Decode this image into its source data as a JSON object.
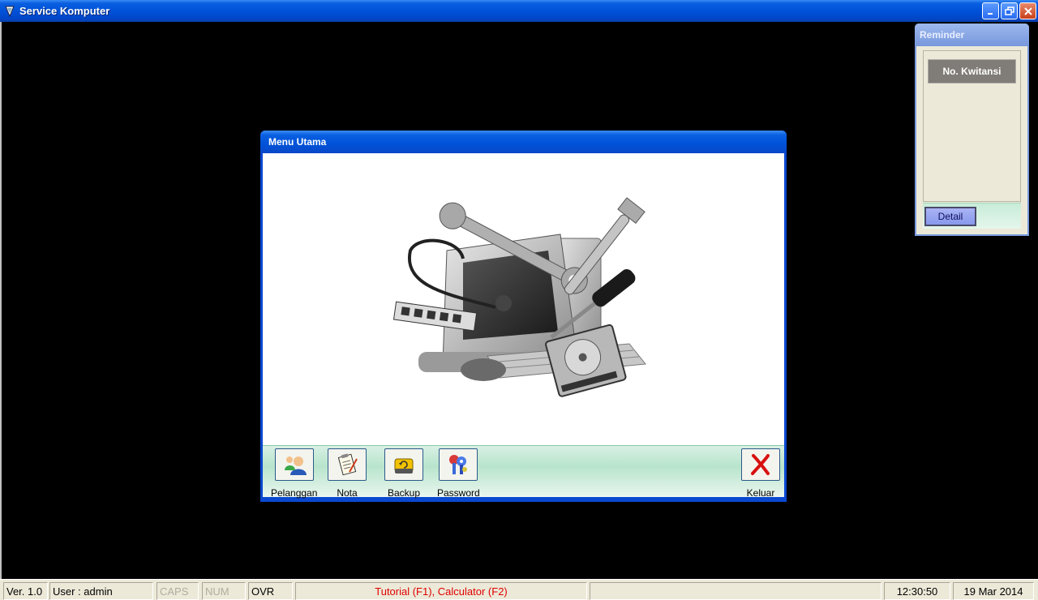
{
  "app": {
    "title": "Service Komputer"
  },
  "menu_window": {
    "title": "Menu Utama",
    "toolbar": [
      {
        "label": "Pelanggan",
        "icon": "customer-icon"
      },
      {
        "label": "Nota",
        "icon": "note-icon"
      },
      {
        "label": "Backup",
        "icon": "backup-icon"
      },
      {
        "label": "Password",
        "icon": "password-keys-icon"
      },
      {
        "label": "Keluar",
        "icon": "exit-icon"
      }
    ]
  },
  "reminder_window": {
    "title": "Reminder",
    "column_header": "No. Kwitansi",
    "detail_button": "Detail"
  },
  "statusbar": {
    "version": "Ver. 1.0",
    "user": "User : admin",
    "caps": "CAPS",
    "num": "NUM",
    "ovr": "OVR",
    "hint": "Tutorial (F1), Calculator (F2)",
    "time": "12:30:50",
    "date": "19 Mar 2014"
  },
  "colors": {
    "titlebar_blue": "#0052d8",
    "hint_red": "#e00000",
    "toolbar_green": "#b8e4cc"
  }
}
